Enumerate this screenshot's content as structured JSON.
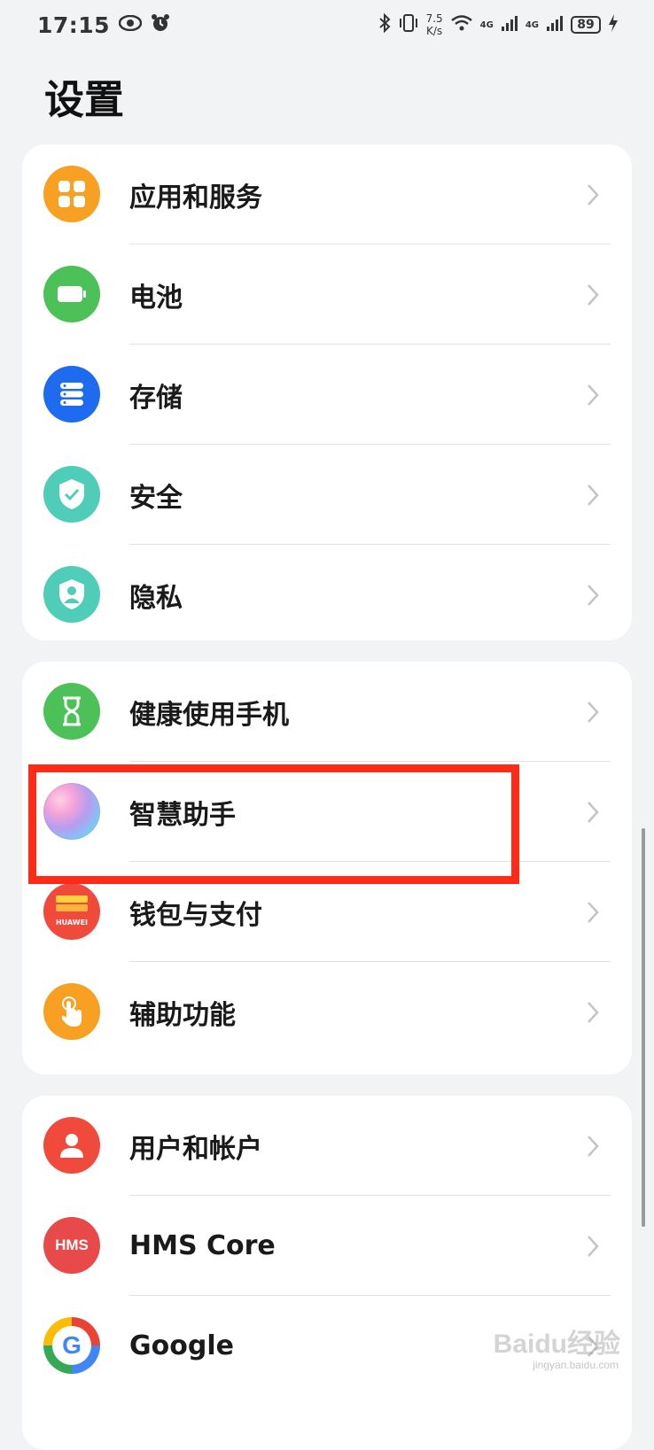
{
  "status_bar": {
    "time": "17:15",
    "net_speed_value": "7.5",
    "net_speed_unit": "K/s",
    "signal1": "4G",
    "signal2": "4G",
    "battery": "89"
  },
  "page_title": "设置",
  "cards": [
    {
      "items": [
        {
          "label": "应用和服务",
          "icon": "apps-icon",
          "color": "#f8a021"
        },
        {
          "label": "电池",
          "icon": "battery-icon",
          "color": "#4cc158"
        },
        {
          "label": "存储",
          "icon": "storage-icon",
          "color": "#1e6bf0"
        },
        {
          "label": "安全",
          "icon": "shield-check-icon",
          "color": "#4fcdb8"
        },
        {
          "label": "隐私",
          "icon": "privacy-shield-icon",
          "color": "#4fcdb8"
        }
      ]
    },
    {
      "items": [
        {
          "label": "健康使用手机",
          "icon": "hourglass-icon",
          "color": "#4cc158"
        },
        {
          "label": "智慧助手",
          "icon": "smart-assistant-icon",
          "color": "#b89cf0"
        },
        {
          "label": "钱包与支付",
          "icon": "huawei-wallet-icon",
          "color": "#ef4a3c",
          "icon_text": "HUAWEI"
        },
        {
          "label": "辅助功能",
          "icon": "accessibility-hand-icon",
          "color": "#f8a021"
        }
      ]
    },
    {
      "items": [
        {
          "label": "用户和帐户",
          "icon": "user-icon",
          "color": "#ef4a3c"
        },
        {
          "label": "HMS Core",
          "icon": "hms-icon",
          "color": "#e84a4a",
          "icon_text": "HMS"
        },
        {
          "label": "Google",
          "icon": "google-icon",
          "color": "#ffffff",
          "icon_text": "G"
        }
      ]
    }
  ],
  "watermark": {
    "brand": "Baidu经验",
    "domain": "jingyan.baidu.com"
  }
}
